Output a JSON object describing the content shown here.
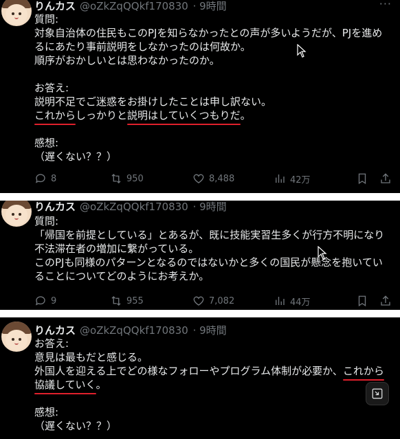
{
  "tweets": [
    {
      "username": "りんカス",
      "handle": "@oZkZqQQkf170830",
      "time": "· 9時間",
      "lines": [
        "質問:",
        "対象自治体の住民もこのPJを知らなかったとの声が多いようだが、PJを進め",
        "るにあたり事前説明をしなかったのは何故か。",
        "順序がおかしいとは思わなかったのか。",
        "",
        "お答え:",
        "説明不足でご迷惑をお掛けしたことは申し訳ない。",
        [
          "これから",
          "しっかりと",
          "説明はしていくつもりだ",
          "。"
        ],
        "",
        "感想:",
        "（遅くない？？）"
      ],
      "replies": "8",
      "reposts": "950",
      "likes": "8,488",
      "views": "42万"
    },
    {
      "username": "りんカス",
      "handle": "@oZkZqQQkf170830",
      "time": "· 9時間",
      "lines": [
        "質問:",
        "「帰国を前提としている」とあるが、既に技能実習生多くが行方不明になり",
        "不法滞在者の増加に繋がっている。",
        "このPJも同様のパターンとなるのではないかと多くの国民が懸念を抱いてい",
        "ることについてどのようにお考えか。"
      ],
      "replies": "9",
      "reposts": "955",
      "likes": "7,082",
      "views": "44万"
    },
    {
      "username": "りんカス",
      "handle": "@oZkZqQQkf170830",
      "time": "· 9時間",
      "lines": [
        "お答え:",
        "意見は最もだと感じる。",
        [
          "外国人を迎える上でどの様なフォローやプログラム体制が必要か、",
          "これから"
        ],
        [
          "協議していく",
          "。"
        ],
        "",
        "感想:",
        "（遅くない？？）"
      ]
    }
  ],
  "more_icon": "···",
  "icons": [
    "reply-icon",
    "repost-icon",
    "like-icon",
    "views-icon",
    "bookmark-icon",
    "share-icon",
    "expand-icon"
  ],
  "colors": {
    "background": "#000000",
    "text": "#e7e9ea",
    "muted": "#71767b",
    "underline": "#e0202c"
  }
}
